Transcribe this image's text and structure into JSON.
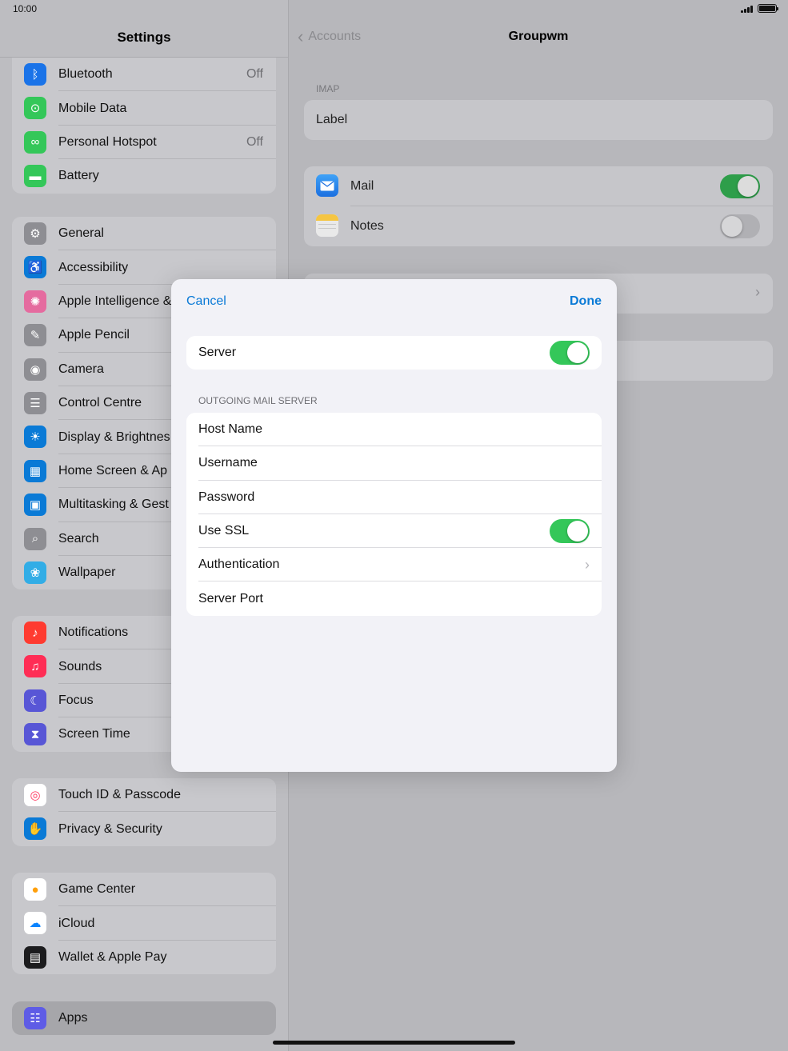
{
  "status_bar": {
    "time": "10:00"
  },
  "sidebar": {
    "title": "Settings",
    "groups": [
      {
        "items": [
          {
            "label": "Bluetooth",
            "value": "Off",
            "icon": "bluetooth-icon",
            "color": "#1a73e8"
          },
          {
            "label": "Mobile Data",
            "value": "",
            "icon": "antenna-icon",
            "color": "#34c759"
          },
          {
            "label": "Personal Hotspot",
            "value": "Off",
            "icon": "hotspot-icon",
            "color": "#34c759"
          },
          {
            "label": "Battery",
            "value": "",
            "icon": "battery-icon",
            "color": "#34c759"
          }
        ]
      },
      {
        "items": [
          {
            "label": "General",
            "icon": "gear-icon",
            "color": "#8e8e93"
          },
          {
            "label": "Accessibility",
            "icon": "accessibility-icon",
            "color": "#0a7ad6"
          },
          {
            "label": "Apple Intelligence &",
            "icon": "apple-intelligence-icon",
            "color": "#e56b9f"
          },
          {
            "label": "Apple Pencil",
            "icon": "pencil-icon",
            "color": "#8e8e93"
          },
          {
            "label": "Camera",
            "icon": "camera-icon",
            "color": "#8e8e93"
          },
          {
            "label": "Control Centre",
            "icon": "toggles-icon",
            "color": "#8e8e93"
          },
          {
            "label": "Display & Brightnes",
            "icon": "sun-icon",
            "color": "#0a7ad6"
          },
          {
            "label": "Home Screen & Ap",
            "icon": "home-screen-icon",
            "color": "#0a7ad6"
          },
          {
            "label": "Multitasking & Gest",
            "icon": "multitasking-icon",
            "color": "#0a7ad6"
          },
          {
            "label": "Search",
            "icon": "search-icon",
            "color": "#8e8e93"
          },
          {
            "label": "Wallpaper",
            "icon": "flower-icon",
            "color": "#32ade6"
          }
        ]
      },
      {
        "items": [
          {
            "label": "Notifications",
            "icon": "bell-icon",
            "color": "#ff3b30"
          },
          {
            "label": "Sounds",
            "icon": "speaker-icon",
            "color": "#ff2d55"
          },
          {
            "label": "Focus",
            "icon": "moon-icon",
            "color": "#5856d6"
          },
          {
            "label": "Screen Time",
            "icon": "hourglass-icon",
            "color": "#5856d6"
          }
        ]
      },
      {
        "items": [
          {
            "label": "Touch ID & Passcode",
            "icon": "fingerprint-icon",
            "color": "#ffffff"
          },
          {
            "label": "Privacy & Security",
            "icon": "hand-icon",
            "color": "#0a7ad6"
          }
        ]
      },
      {
        "items": [
          {
            "label": "Game Center",
            "icon": "game-center-icon",
            "color": "#ffffff"
          },
          {
            "label": "iCloud",
            "icon": "cloud-icon",
            "color": "#ffffff"
          },
          {
            "label": "Wallet & Apple Pay",
            "icon": "wallet-icon",
            "color": "#1c1c1e"
          }
        ]
      },
      {
        "items": [
          {
            "label": "Apps",
            "icon": "apps-grid-icon",
            "color": "#5e5ce6"
          }
        ]
      }
    ]
  },
  "detail": {
    "back_label": "Accounts",
    "title": "Groupwm",
    "section_caption": "IMAP",
    "label_row": "Label",
    "mail_label": "Mail",
    "mail_on": true,
    "notes_label": "Notes",
    "notes_on": false
  },
  "modal": {
    "cancel_label": "Cancel",
    "done_label": "Done",
    "server_label": "Server",
    "server_on": true,
    "outgoing_caption": "OUTGOING MAIL SERVER",
    "fields": {
      "host_name": "Host Name",
      "username": "Username",
      "password": "Password",
      "use_ssl": "Use SSL",
      "authentication": "Authentication",
      "server_port": "Server Port"
    },
    "use_ssl_on": true
  }
}
